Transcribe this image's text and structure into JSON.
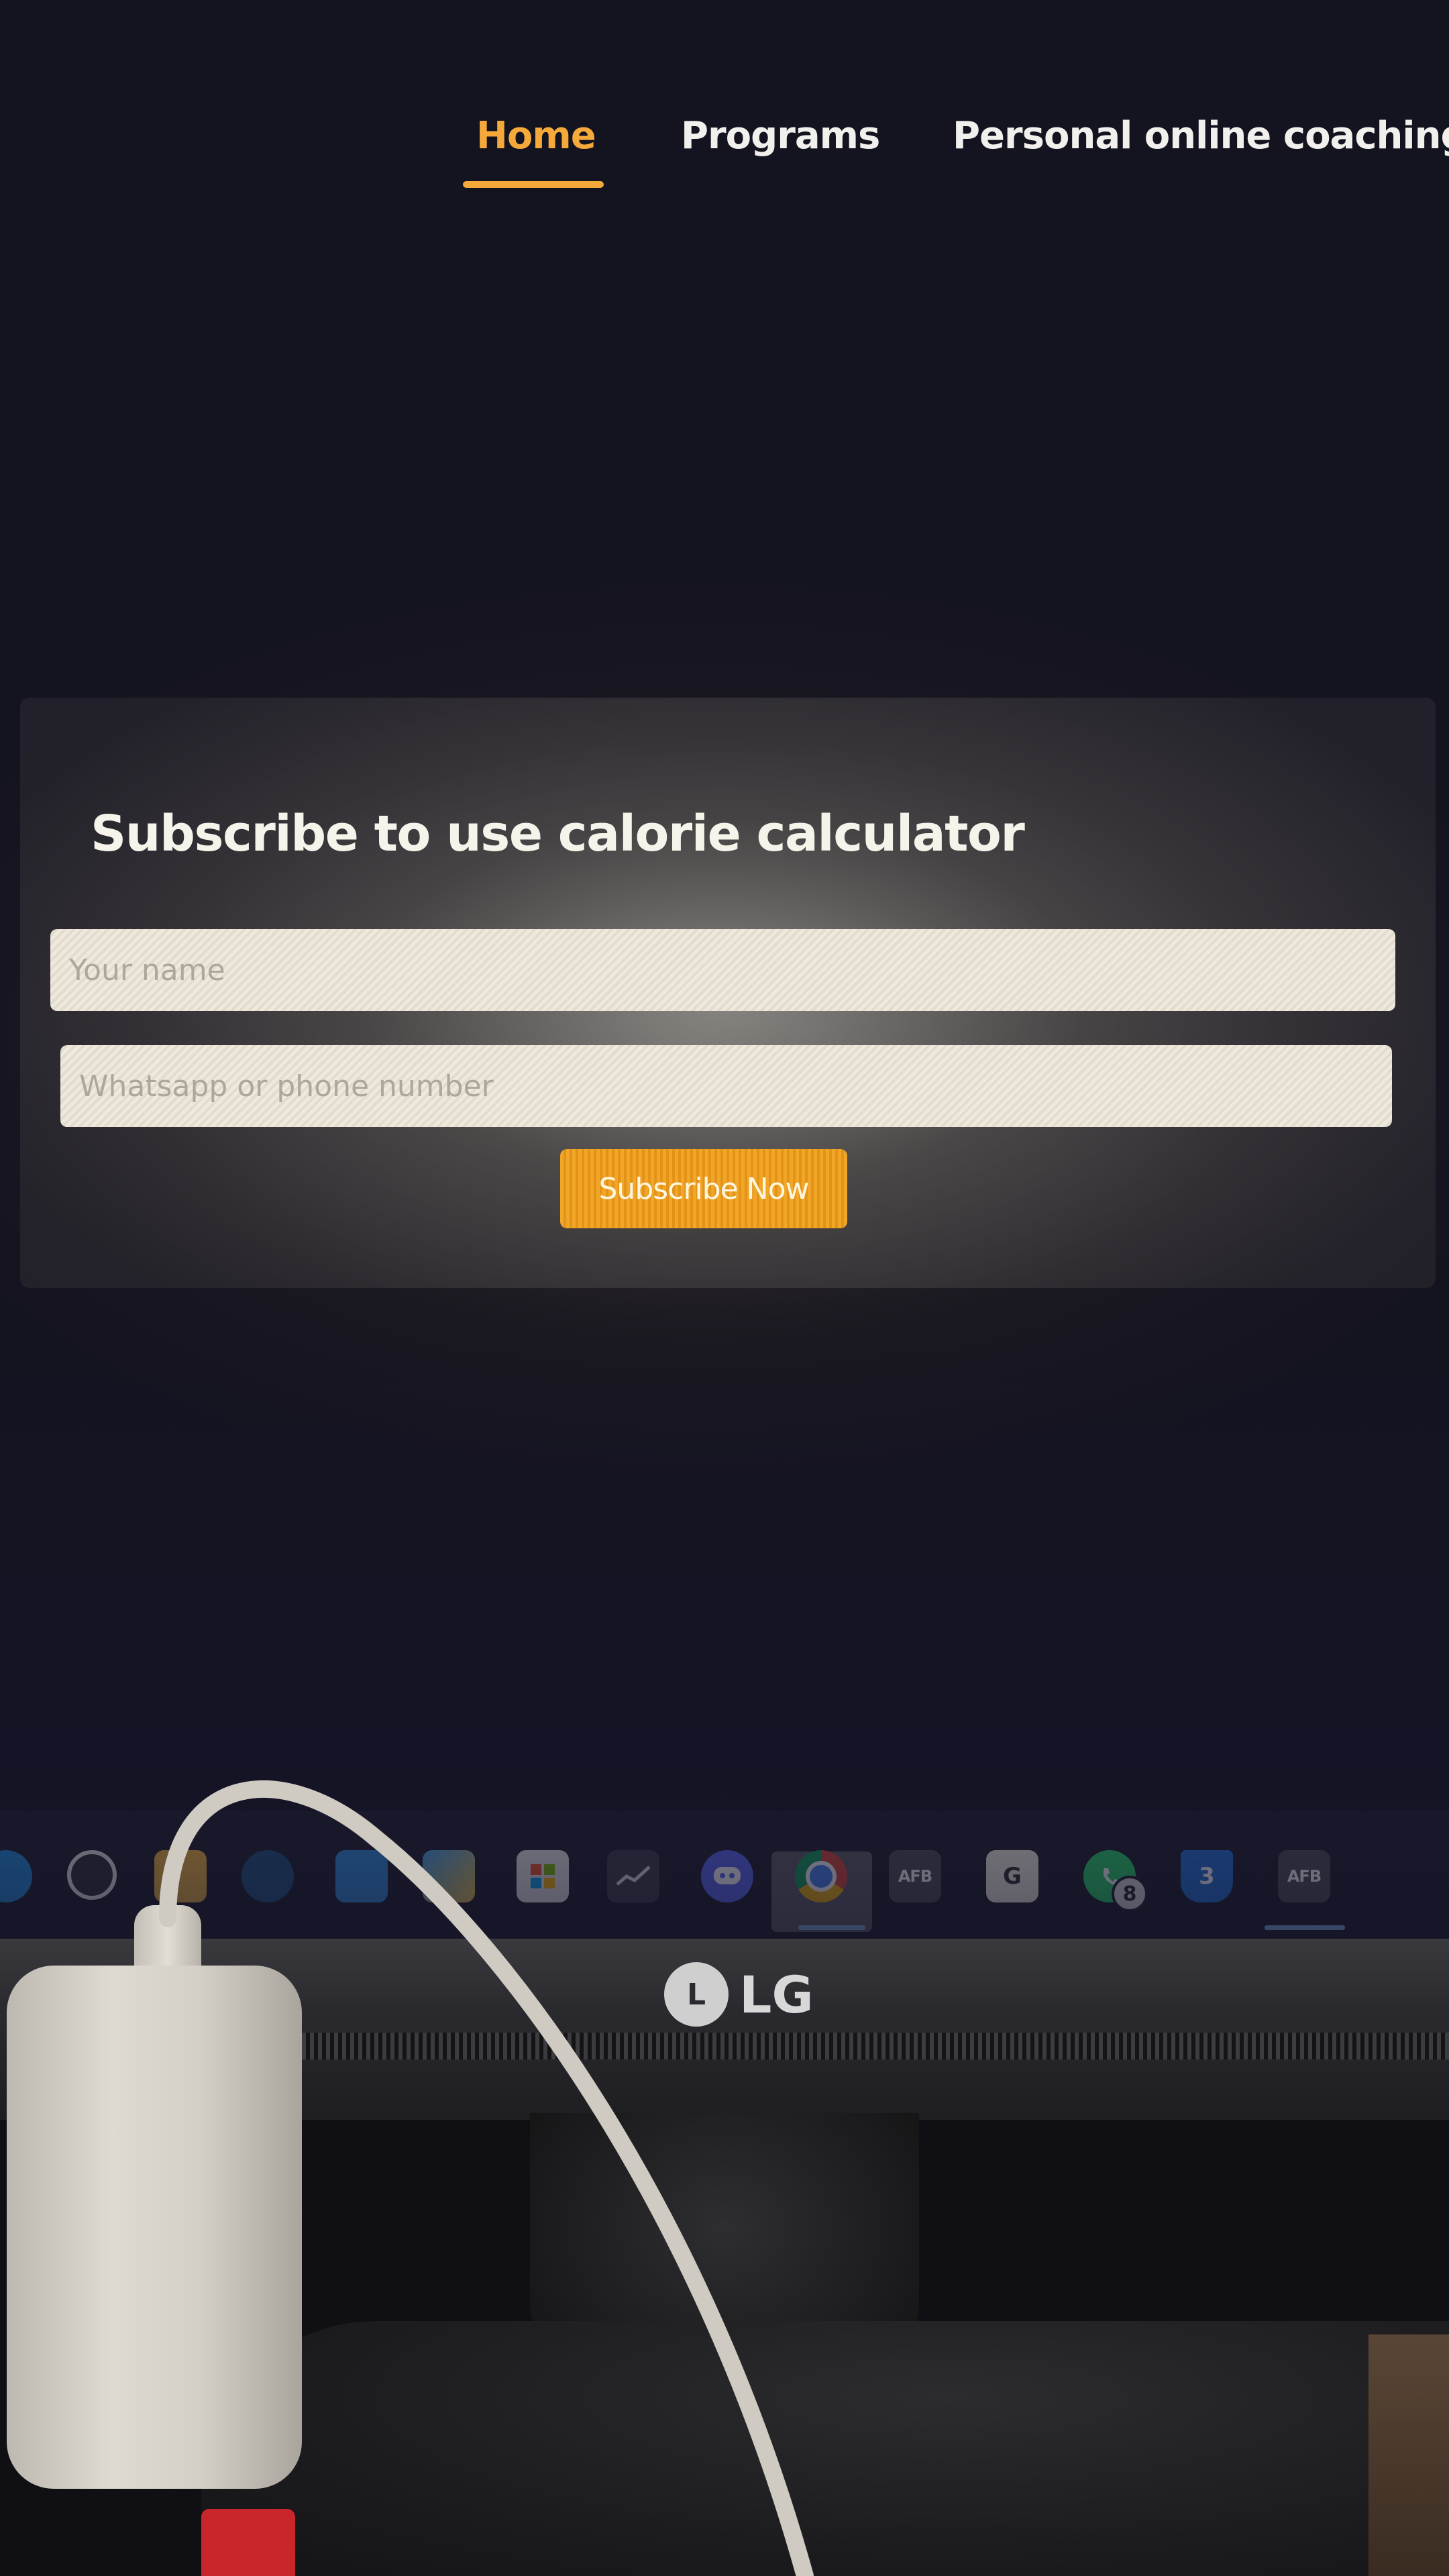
{
  "nav": {
    "items": [
      {
        "label": "Home",
        "active": true
      },
      {
        "label": "Programs",
        "active": false
      },
      {
        "label": "Personal online coaching",
        "active": false
      }
    ]
  },
  "subscribe": {
    "title": "Subscribe to use calorie calculator",
    "name_placeholder": "Your name",
    "phone_placeholder": "Whatsapp or phone number",
    "button_label": "Subscribe Now"
  },
  "taskbar": {
    "icons": [
      {
        "name": "edge-icon"
      },
      {
        "name": "obs-icon"
      },
      {
        "name": "file-explorer-icon"
      },
      {
        "name": "steam-icon"
      },
      {
        "name": "app-icon"
      },
      {
        "name": "photos-icon"
      },
      {
        "name": "microsoft-store-icon"
      },
      {
        "name": "system-monitor-icon"
      },
      {
        "name": "discord-icon"
      },
      {
        "name": "chrome-icon"
      },
      {
        "name": "afb-app-icon",
        "label": "AFB"
      },
      {
        "name": "google-app-icon",
        "label": "G"
      },
      {
        "name": "whatsapp-icon",
        "badge": "8"
      },
      {
        "name": "three-app-icon",
        "label": "3"
      },
      {
        "name": "afb-app-icon-2",
        "label": "AFB"
      }
    ]
  },
  "monitor": {
    "brand": "LG"
  },
  "colors": {
    "accent": "#f4a93a",
    "button": "#f2a628",
    "background": "#141320"
  }
}
